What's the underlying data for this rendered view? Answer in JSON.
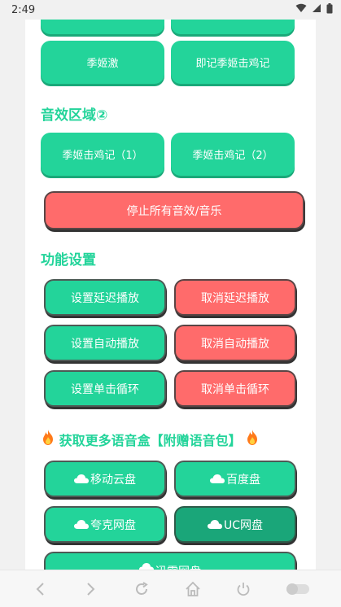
{
  "status_bar": {
    "time": "2:49"
  },
  "top_row": {
    "left": "",
    "right": ""
  },
  "row2": {
    "left": "季姬激",
    "right": "即记季姬击鸡记"
  },
  "section_sfx2": {
    "title": "音效区域②"
  },
  "sfx2_buttons": {
    "left": "季姬击鸡记（1）",
    "right": "季姬击鸡记（2）"
  },
  "stop_all": {
    "label": "停止所有音效/音乐"
  },
  "section_settings": {
    "title": "功能设置"
  },
  "settings": {
    "set_delay": "设置延迟播放",
    "cancel_delay": "取消延迟播放",
    "set_auto": "设置自动播放",
    "cancel_auto": "取消自动播放",
    "set_loop": "设置单击循环",
    "cancel_loop": "取消单击循环"
  },
  "section_more": {
    "title": "获取更多语音盒【附赠语音包】"
  },
  "clouds": {
    "mobile": "移动云盘",
    "baidu": "百度盘",
    "quark": "夸克网盘",
    "uc": "UC网盘",
    "xunlei": "迅雷网盘"
  },
  "colors": {
    "accent_green": "#23d49a",
    "dark_green": "#1aa679",
    "red": "#ff6b6b"
  }
}
